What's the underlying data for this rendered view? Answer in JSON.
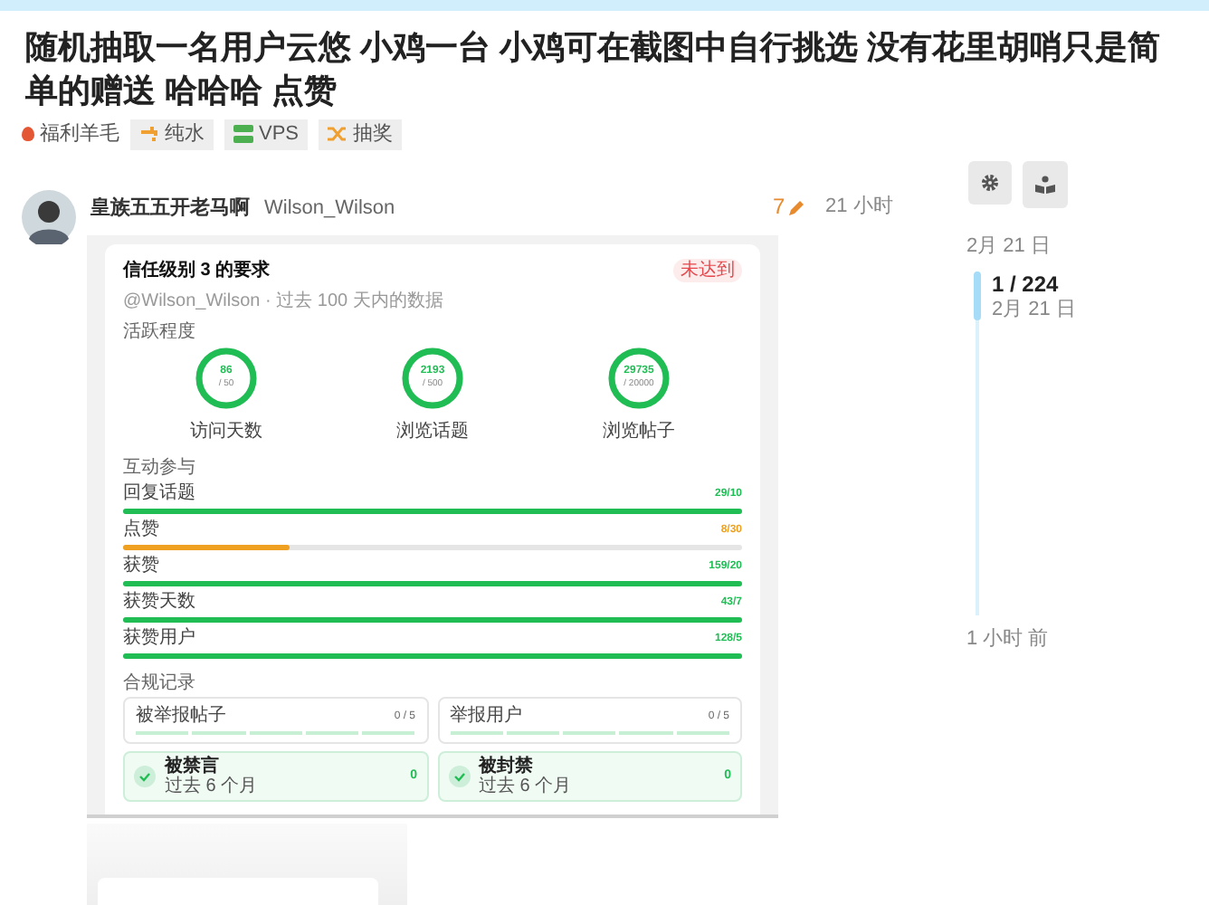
{
  "title": "随机抽取一名用户云悠 小鸡一台 小鸡可在截图中自行挑选 没有花里胡哨只是简单的赠送 哈哈哈 点赞",
  "category": {
    "label": "福利羊毛",
    "color": "#e45735"
  },
  "tags": [
    {
      "label": "纯水"
    },
    {
      "label": "VPS"
    },
    {
      "label": "抽奖"
    }
  ],
  "post": {
    "display_name": "皇族五五开老马啊",
    "username": "Wilson_Wilson",
    "edits": "7",
    "time": "21 小时"
  },
  "screenshot": {
    "title": "信任级别 3 的要求",
    "badge": "未达到",
    "subtitle": "@Wilson_Wilson · 过去 100 天内的数据",
    "activity_heading": "活跃程度",
    "rings": [
      {
        "value": "86",
        "target": "/ 50",
        "label": "访问天数",
        "level": 1
      },
      {
        "value": "2193",
        "target": "/ 500",
        "label": "浏览话题",
        "level": 1
      },
      {
        "value": "29735",
        "target": "/ 20000",
        "label": "浏览帖子",
        "level": 1
      }
    ],
    "interaction_heading": "互动参与",
    "bars": [
      {
        "label": "回复话题",
        "reading": "29/10",
        "level": 1,
        "met": true
      },
      {
        "label": "点赞",
        "reading": "8/30",
        "level": 0.27,
        "met": false
      },
      {
        "label": "获赞",
        "reading": "159/20",
        "level": 1,
        "met": true
      },
      {
        "label": "获赞天数",
        "reading": "43/7",
        "level": 1,
        "met": true
      },
      {
        "label": "获赞用户",
        "reading": "128/5",
        "level": 1,
        "met": true
      }
    ],
    "compliance_heading": "合规记录",
    "counters": [
      {
        "label": "被举报帖子",
        "reading": "0 / 5"
      },
      {
        "label": "举报用户",
        "reading": "0 / 5"
      }
    ],
    "records": [
      {
        "label": "被禁言",
        "period": "过去 6 个月",
        "count": "0"
      },
      {
        "label": "被封禁",
        "period": "过去 6 个月",
        "count": "0"
      }
    ]
  },
  "timeline": {
    "start": "2月 21 日",
    "position": "1 / 224",
    "position_date": "2月 21 日",
    "end": "1 小时 前"
  }
}
